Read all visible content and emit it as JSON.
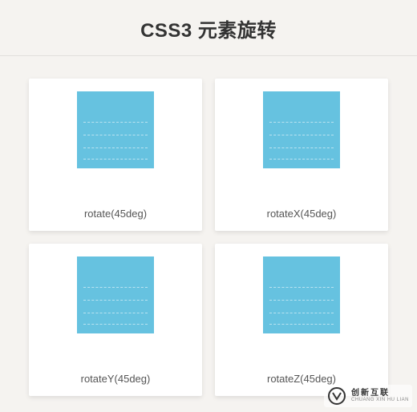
{
  "header": {
    "title": "CSS3 元素旋转"
  },
  "cards": [
    {
      "caption": "rotate(45deg)"
    },
    {
      "caption": "rotateX(45deg)"
    },
    {
      "caption": "rotateY(45deg)"
    },
    {
      "caption": "rotateZ(45deg)"
    }
  ],
  "watermark": {
    "cn": "创新互联",
    "en": "CHUANG XIN HU LIAN"
  }
}
